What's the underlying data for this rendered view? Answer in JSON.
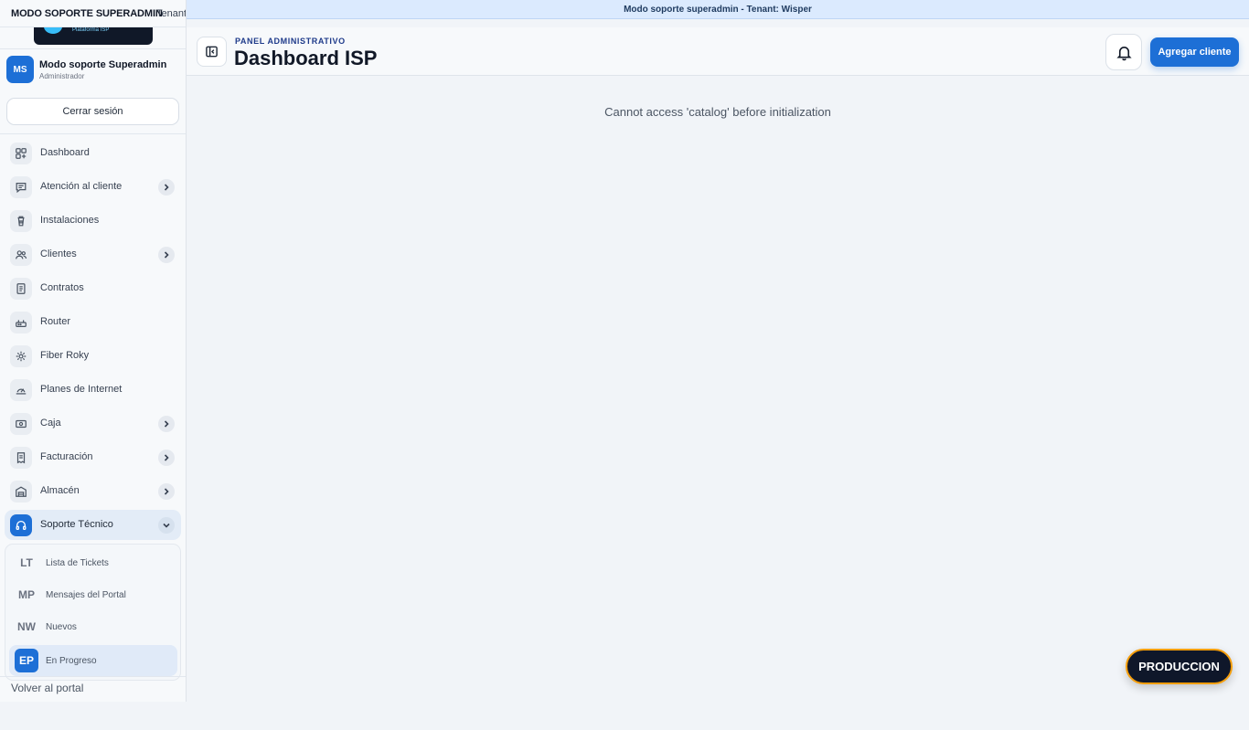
{
  "banner": {
    "text": "Modo soporte superadmin - Tenant: Wisper"
  },
  "sidebar": {
    "mode_label": "MODO SOPORTE SUPERADMIN",
    "tenant_label": "Tenant",
    "logo_text": "Plataforma ISP",
    "user": {
      "initials": "MS",
      "name": "Modo soporte Superadmin",
      "role": "Administrador"
    },
    "logout_label": "Cerrar sesión",
    "items": [
      {
        "label": "Dashboard",
        "icon": "dashboard-icon",
        "has_children": false
      },
      {
        "label": "Atención al cliente",
        "icon": "chat-icon",
        "has_children": true
      },
      {
        "label": "Instalaciones",
        "icon": "install-icon",
        "has_children": false
      },
      {
        "label": "Clientes",
        "icon": "users-icon",
        "has_children": true
      },
      {
        "label": "Contratos",
        "icon": "document-icon",
        "has_children": false
      },
      {
        "label": "Router",
        "icon": "router-icon",
        "has_children": false
      },
      {
        "label": "Fiber Roky",
        "icon": "sparkle-icon",
        "has_children": false
      },
      {
        "label": "Planes de Internet",
        "icon": "speed-icon",
        "has_children": false
      },
      {
        "label": "Caja",
        "icon": "cash-icon",
        "has_children": true
      },
      {
        "label": "Facturación",
        "icon": "invoice-icon",
        "has_children": true
      },
      {
        "label": "Almacén",
        "icon": "warehouse-icon",
        "has_children": true
      },
      {
        "label": "Soporte Técnico",
        "icon": "headset-icon",
        "has_children": true,
        "expanded": true
      }
    ],
    "submenu": [
      {
        "abbr": "LT",
        "label": "Lista de Tickets"
      },
      {
        "abbr": "MP",
        "label": "Mensajes del Portal"
      },
      {
        "abbr": "NW",
        "label": "Nuevos"
      },
      {
        "abbr": "EP",
        "label": "En Progreso",
        "active": true
      }
    ],
    "back_label": "Volver al portal"
  },
  "header": {
    "kicker": "PANEL ADMINISTRATIVO",
    "title": "Dashboard ISP",
    "add_button": "Agregar cliente"
  },
  "main": {
    "error": "Cannot access 'catalog' before initialization"
  },
  "env_badge": "PRODUCCION",
  "colors": {
    "accent": "#1d6fd6",
    "banner_bg": "#dbeafe",
    "badge_border": "#f59e0b",
    "badge_bg": "#0f172a"
  }
}
